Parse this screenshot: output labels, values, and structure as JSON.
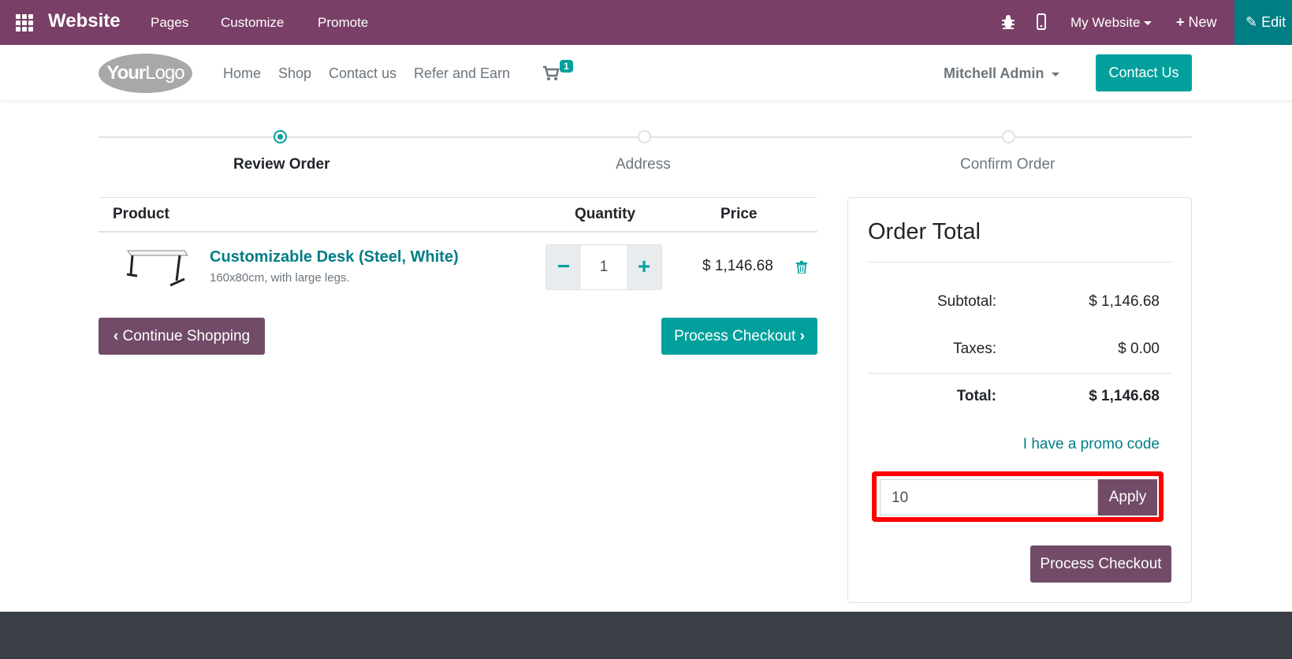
{
  "topbar": {
    "app_title": "Website",
    "menu": [
      "Pages",
      "Customize",
      "Promote"
    ],
    "site_selector": "My Website",
    "new_label": "New",
    "edit_label": "Edit"
  },
  "header": {
    "logo_text_bold": "Your",
    "logo_text": "Logo",
    "nav": [
      "Home",
      "Shop",
      "Contact us",
      "Refer and Earn"
    ],
    "cart_count": "1",
    "user": "Mitchell Admin",
    "contact_button": "Contact Us"
  },
  "steps": [
    {
      "label": "Review Order",
      "active": true
    },
    {
      "label": "Address",
      "active": false
    },
    {
      "label": "Confirm Order",
      "active": false
    }
  ],
  "cart": {
    "columns": [
      "Product",
      "Quantity",
      "Price"
    ],
    "items": [
      {
        "name": "Customizable Desk (Steel, White)",
        "description": "160x80cm, with large legs.",
        "quantity": "1",
        "price": "$ 1,146.68"
      }
    ],
    "continue_label": "Continue Shopping",
    "process_label": "Process Checkout"
  },
  "order_total": {
    "title": "Order Total",
    "subtotal_label": "Subtotal:",
    "subtotal_value": "$ 1,146.68",
    "taxes_label": "Taxes:",
    "taxes_value": "$ 0.00",
    "total_label": "Total:",
    "total_value": "$ 1,146.68",
    "promo_link": "I have a promo code",
    "promo_value": "10",
    "apply_label": "Apply",
    "process_label": "Process Checkout"
  },
  "colors": {
    "topbar": "#7a3f67",
    "primary": "#01a09d",
    "secondary": "#714b67",
    "highlight": "#ff0000",
    "footer": "#3a3f46"
  }
}
